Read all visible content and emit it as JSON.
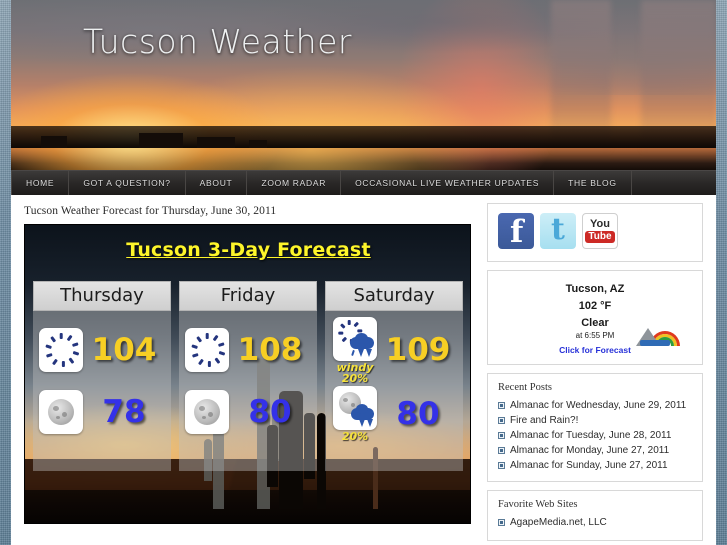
{
  "site": {
    "title": "Tucson Weather"
  },
  "nav": {
    "items": [
      {
        "label": "Home",
        "name": "home"
      },
      {
        "label": "Got a Question?",
        "name": "got-a-question"
      },
      {
        "label": "About",
        "name": "about"
      },
      {
        "label": "Zoom Radar",
        "name": "zoom-radar"
      },
      {
        "label": "Occasional Live Weather Updates",
        "name": "occasional-live-weather-updates"
      },
      {
        "label": "The Blog",
        "name": "the-blog"
      }
    ]
  },
  "main": {
    "post_title": "Tucson Weather Forecast for Thursday, June 30, 2011",
    "forecast": {
      "title": "Tucson 3-Day Forecast",
      "title_color": "#fdf52a",
      "high_color": "#f7cf24",
      "low_color": "#3431e8",
      "days": [
        {
          "name": "Thursday",
          "day_icon": "sun-icon",
          "day_note": "",
          "high": "104",
          "night_icon": "moon-icon",
          "night_note": "",
          "low": "78"
        },
        {
          "name": "Friday",
          "day_icon": "sun-icon",
          "day_note": "",
          "high": "108",
          "night_icon": "moon-icon",
          "night_note": "",
          "low": "80"
        },
        {
          "name": "Saturday",
          "day_icon": "sun-cloud-thunder-icon",
          "day_note": "windy\n20%",
          "day_note_line1": "windy",
          "day_note_line2": "20%",
          "high": "109",
          "night_icon": "moon-cloud-thunder-icon",
          "night_note": "20%",
          "low": "80"
        }
      ]
    }
  },
  "sidebar": {
    "social": [
      {
        "name": "facebook-icon",
        "label": "f"
      },
      {
        "name": "twitter-icon",
        "label": "t"
      },
      {
        "name": "youtube-icon",
        "label_top": "You",
        "label_bottom": "Tube"
      }
    ],
    "weather_widget": {
      "city": "Tucson, AZ",
      "temperature": "102 °F",
      "condition": "Clear",
      "time": "at  6:55 PM",
      "link": "Click for Forecast",
      "link_color": "#2731d8"
    },
    "recent_posts": {
      "title": "Recent Posts",
      "items": [
        "Almanac for Wednesday, June 29, 2011",
        "Fire and Rain?!",
        "Almanac for Tuesday, June 28, 2011",
        "Almanac for Monday, June 27, 2011",
        "Almanac for Sunday, June 27, 2011"
      ]
    },
    "favorite_sites": {
      "title": "Favorite Web Sites",
      "items": [
        "AgapeMedia.net, LLC"
      ]
    }
  }
}
